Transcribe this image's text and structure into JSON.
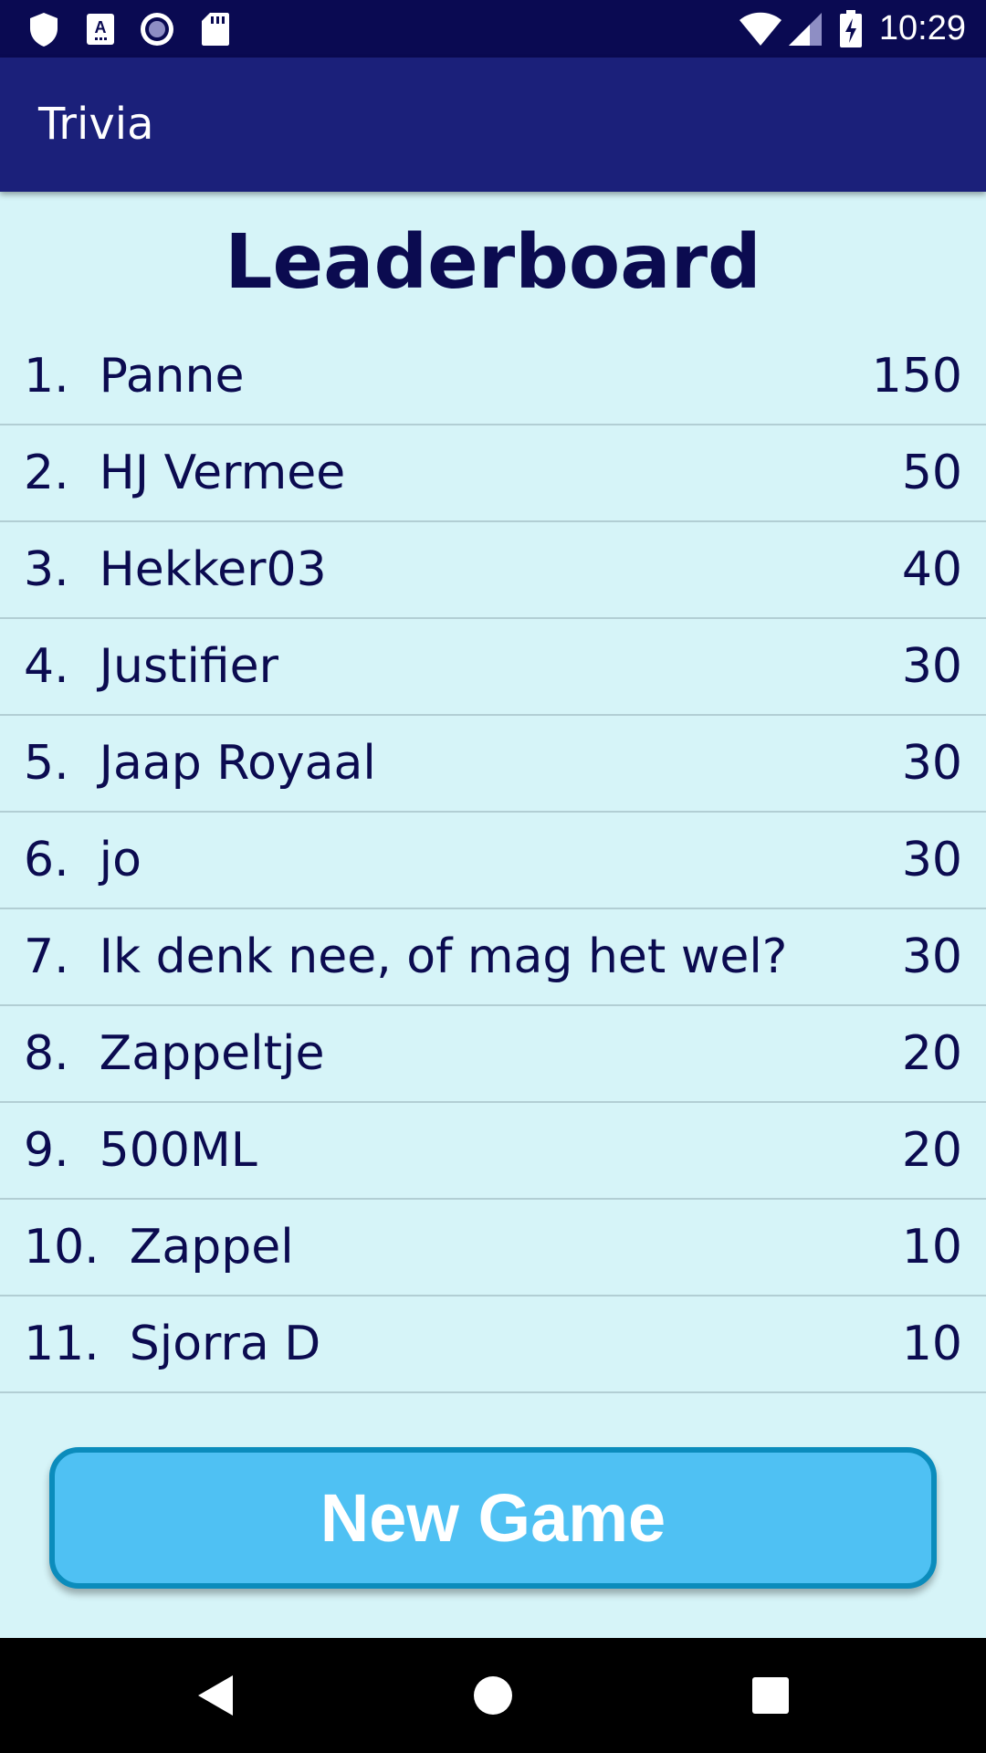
{
  "status_bar": {
    "time": "10:29",
    "icons": [
      "shield-icon",
      "keyboard-a-icon",
      "record-icon",
      "sd-card-icon",
      "wifi-icon",
      "cell-signal-icon",
      "battery-charging-icon"
    ]
  },
  "app_bar": {
    "title": "Trivia"
  },
  "leaderboard": {
    "title": "Leaderboard",
    "entries": [
      {
        "rank": "1.  ",
        "name": "Panne",
        "score": "150"
      },
      {
        "rank": "2.  ",
        "name": "HJ Vermee",
        "score": "50"
      },
      {
        "rank": "3.  ",
        "name": "Hekker03",
        "score": "40"
      },
      {
        "rank": "4.  ",
        "name": "Justifier",
        "score": "30"
      },
      {
        "rank": "5.  ",
        "name": "Jaap Royaal",
        "score": "30"
      },
      {
        "rank": "6.  ",
        "name": "jo",
        "score": "30"
      },
      {
        "rank": "7.  ",
        "name": "Ik denk nee, of mag het wel?",
        "score": "30"
      },
      {
        "rank": "8.  ",
        "name": "Zappeltje",
        "score": "20"
      },
      {
        "rank": "9.  ",
        "name": "500ML",
        "score": "20"
      },
      {
        "rank": "10.  ",
        "name": "Zappel",
        "score": "10"
      },
      {
        "rank": "11.  ",
        "name": "Sjorra D",
        "score": "10"
      }
    ]
  },
  "actions": {
    "new_game_label": "New Game"
  },
  "nav_bar": {
    "icons": [
      "back-icon",
      "home-icon",
      "recents-icon"
    ]
  },
  "colors": {
    "status_bar": "#0a0a52",
    "app_bar": "#1b207a",
    "background": "#d6f4f8",
    "text": "#0b0b50",
    "button_fill": "#4fc1f3",
    "button_border": "#0b8cbc"
  }
}
